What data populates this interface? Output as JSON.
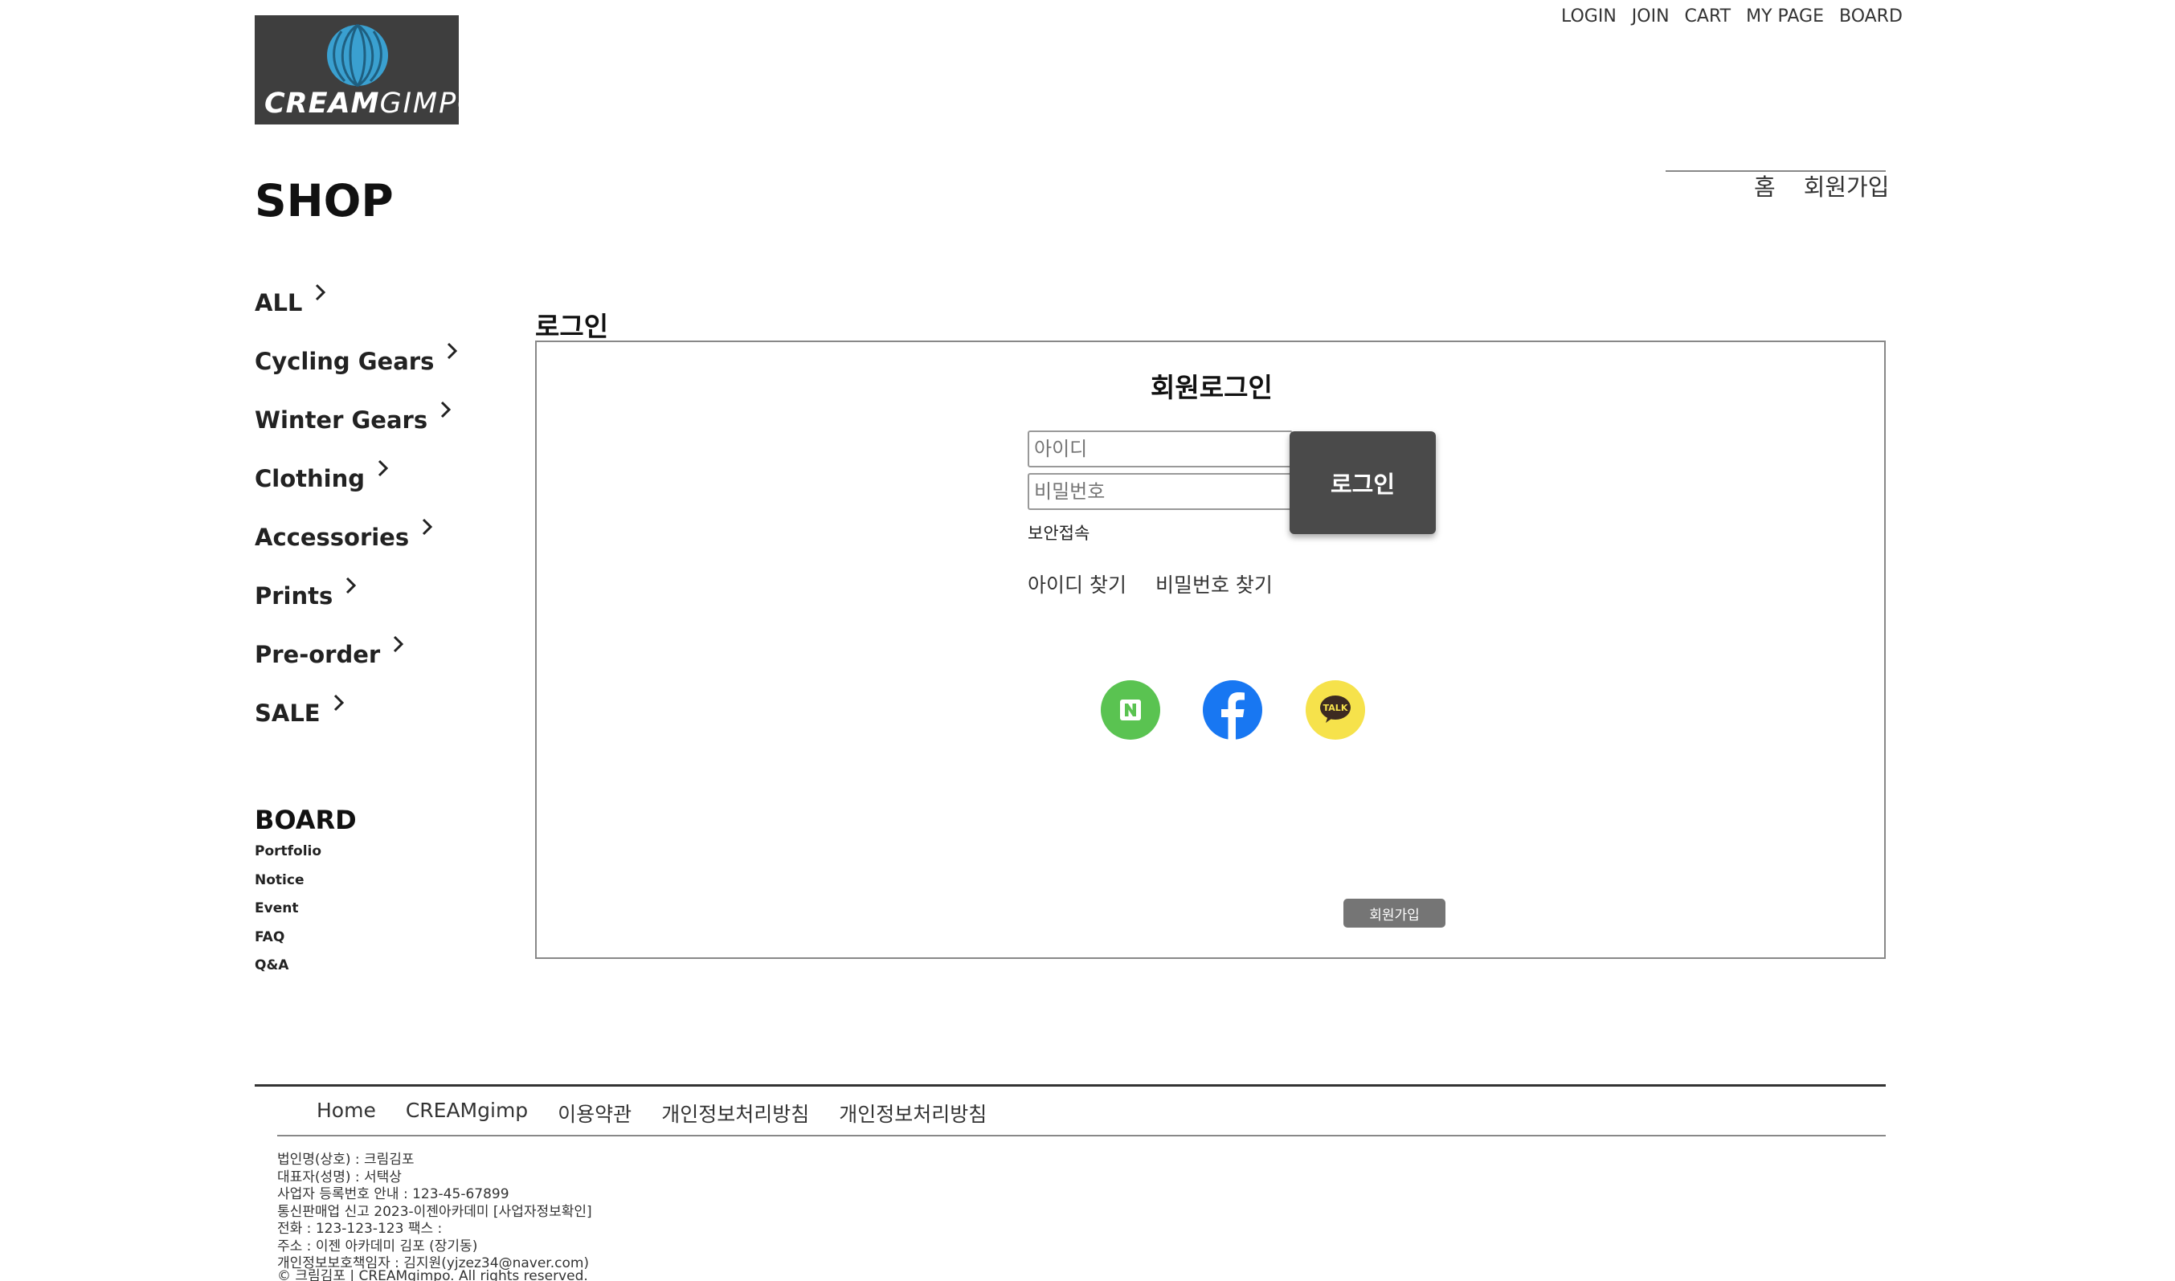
{
  "top_nav": [
    "LOGIN",
    "JOIN",
    "CART",
    "MY PAGE",
    "BOARD"
  ],
  "logo": {
    "text_bold": "CREAM",
    "text_light": "GIMPO",
    "color": "#3e3e3e",
    "accent": "#3aa0d0"
  },
  "sidebar": {
    "shop_title": "SHOP",
    "categories": [
      "ALL",
      "Cycling Gears",
      "Winter Gears",
      "Clothing",
      "Accessories",
      "Prints",
      "Pre-order",
      "SALE"
    ],
    "board_title": "BOARD",
    "board_links": [
      "Portfolio",
      "Notice",
      "Event",
      "FAQ",
      "Q&A"
    ]
  },
  "breadcrumb": [
    "홈",
    "회원가입"
  ],
  "login": {
    "section_title": "로그인",
    "member_title": "회원로그인",
    "id_placeholder": "아이디",
    "pw_placeholder": "비밀번호",
    "login_button": "로그인",
    "secure_label": "보안접속",
    "find_id": "아이디 찾기",
    "find_pw": "비밀번호 찾기",
    "social": [
      {
        "name": "naver-icon",
        "color": "#5ac351"
      },
      {
        "name": "facebook-icon",
        "color": "#1877f2"
      },
      {
        "name": "kakao-talk-icon",
        "color": "#f6e24b"
      }
    ],
    "kakao_label": "TALK",
    "join_button": "회원가입"
  },
  "footer": {
    "links": [
      "Home",
      "CREAMgimp",
      "이용약관",
      "개인정보처리방침",
      "개인정보처리방침"
    ],
    "info": [
      "법인명(상호) : 크림김포",
      "대표자(성명) : 서택상",
      "사업자 등록번호 안내 : 123-45-67899",
      "통신판매업 신고 2023-이젠아카데미 [사업자정보확인]",
      "전화 : 123-123-123 팩스 :",
      "주소 : 이젠 아카데미 김포 (장기동)",
      "개인정보보호책임자 : 김지원(yjzez34@naver.com)"
    ],
    "copyright": "© 크림김포 | CREAMgimpo. All rights reserved."
  }
}
